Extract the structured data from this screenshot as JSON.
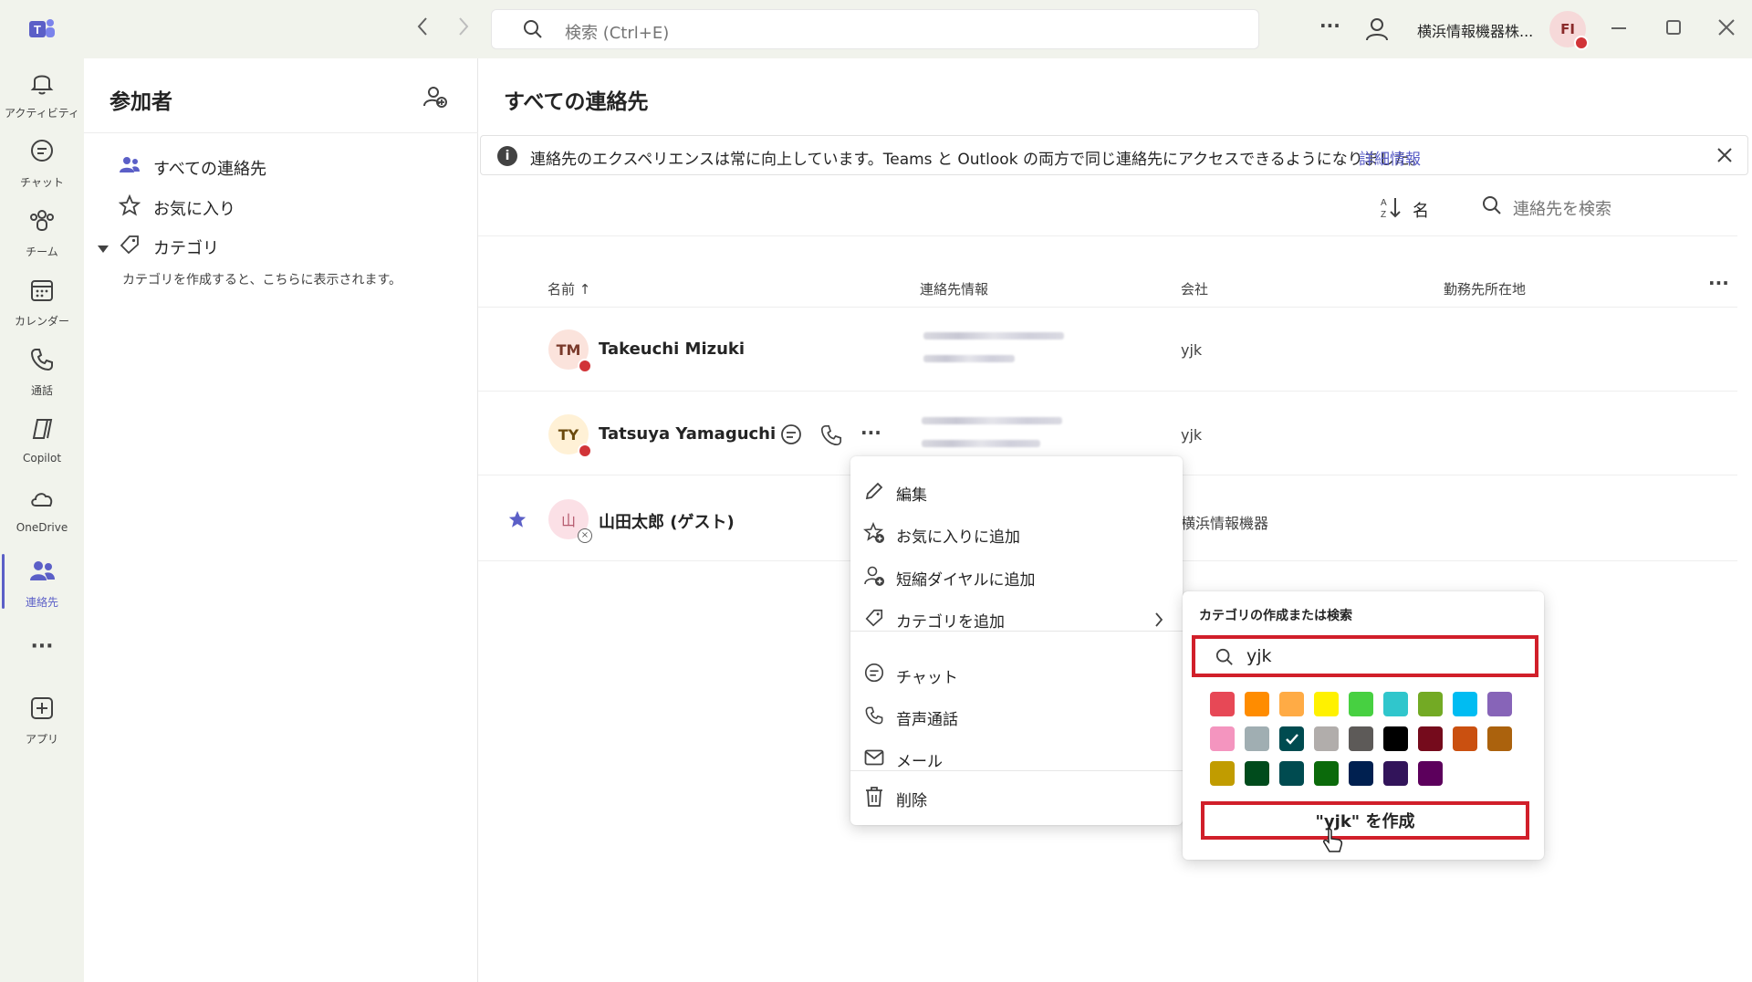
{
  "topbar": {
    "search_placeholder": "検索 (Ctrl+E)",
    "more_label": "···",
    "org_name": "横浜情報機器株...",
    "avatar_initials": "FI"
  },
  "rail": {
    "items": [
      {
        "label": "アクティビティ",
        "icon": "bell-icon"
      },
      {
        "label": "チャット",
        "icon": "chat-icon"
      },
      {
        "label": "チーム",
        "icon": "teams-icon"
      },
      {
        "label": "カレンダー",
        "icon": "calendar-icon"
      },
      {
        "label": "通話",
        "icon": "phone-icon"
      },
      {
        "label": "Copilot",
        "icon": "copilot-icon"
      },
      {
        "label": "OneDrive",
        "icon": "cloud-icon"
      },
      {
        "label": "連絡先",
        "icon": "people-icon"
      },
      {
        "label": "···",
        "icon": "more-icon"
      },
      {
        "label": "アプリ",
        "icon": "apps-icon"
      }
    ],
    "active_color": "#5b5fc7"
  },
  "leftpanel": {
    "title": "参加者",
    "items": [
      {
        "label": "すべての連絡先"
      },
      {
        "label": "お気に入り"
      },
      {
        "label": "カテゴリ"
      }
    ],
    "category_hint": "カテゴリを作成すると、こちらに表示されます。"
  },
  "main": {
    "title": "すべての連絡先",
    "banner_text": "連絡先のエクスペリエンスは常に向上しています。Teams と Outlook の両方で同じ連絡先にアクセスできるようになりました。",
    "banner_link": "詳細情報",
    "sort_label": "名",
    "search_placeholder": "連絡先を検索",
    "columns": {
      "name": "名前 ↑",
      "contact": "連絡先情報",
      "company": "会社",
      "location": "勤務先所在地"
    },
    "contacts": [
      {
        "initials": "TM",
        "name": "Takeuchi Mizuki",
        "company": "yjk",
        "favorite": false
      },
      {
        "initials": "TY",
        "name": "Tatsuya Yamaguchi",
        "company": "yjk",
        "favorite": false
      },
      {
        "initials": "山",
        "name": "山田太郎 (ゲスト)",
        "company": "横浜情報機器",
        "favorite": true
      }
    ]
  },
  "context_menu": {
    "items": [
      {
        "label": "編集",
        "icon": "pencil-icon"
      },
      {
        "label": "お気に入りに追加",
        "icon": "star-add-icon"
      },
      {
        "label": "短縮ダイヤルに追加",
        "icon": "person-add-icon"
      },
      {
        "label": "カテゴリを追加",
        "icon": "tag-icon"
      },
      {
        "label": "チャット",
        "icon": "chat-icon"
      },
      {
        "label": "音声通話",
        "icon": "phone-icon"
      },
      {
        "label": "メール",
        "icon": "mail-icon"
      },
      {
        "label": "削除",
        "icon": "trash-icon"
      }
    ]
  },
  "category_flyout": {
    "title": "カテゴリの作成または検索",
    "input_value": "yjk",
    "create_label": "\"yjk\" を作成",
    "selected_color": "#004b50",
    "colors": [
      "#e74856",
      "#ff8c00",
      "#ffab45",
      "#fff100",
      "#47d041",
      "#30c6cc",
      "#73aa24",
      "#00bcf2",
      "#8764b8",
      "#f495bf",
      "#a0aeb2",
      "#004b50",
      "#b1adab",
      "#5d5a58",
      "#000000",
      "#750b1c",
      "#ca5010",
      "#ab620d",
      "#c19c00",
      "#004b1c",
      "#004b50",
      "#0b6a0b",
      "#002050",
      "#32145a",
      "#5c005c"
    ]
  }
}
